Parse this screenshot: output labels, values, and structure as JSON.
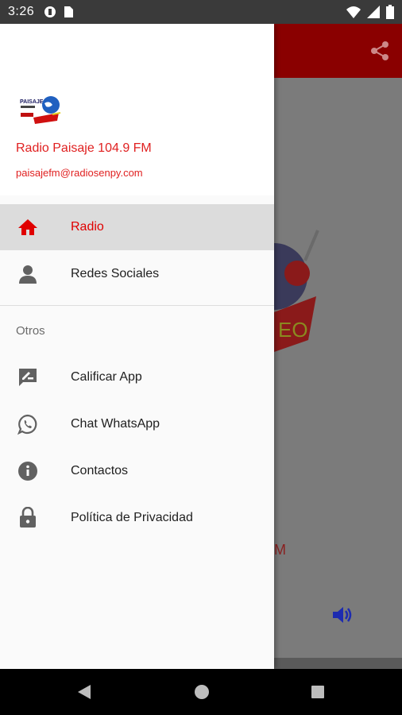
{
  "status_bar": {
    "time": "3:26",
    "left_icons": [
      "vpn-key-icon",
      "sim-card-icon"
    ],
    "right_icons": [
      "wifi-icon",
      "signal-icon",
      "battery-icon"
    ]
  },
  "toolbar": {
    "color": "#8a0000",
    "share_icon": "share-icon"
  },
  "drawer": {
    "header": {
      "station_name": "Radio Paisaje 104.9 FM",
      "email": "paisajefm@radiosenpy.com",
      "logo_text": "PAISAJE"
    },
    "items": [
      {
        "label": "Radio",
        "icon": "home-icon",
        "active": true
      },
      {
        "label": "Redes Sociales",
        "icon": "person-icon",
        "active": false
      }
    ],
    "section_title": "Otros",
    "other_items": [
      {
        "label": "Calificar App",
        "icon": "rate-review-icon"
      },
      {
        "label": "Chat WhatsApp",
        "icon": "whatsapp-icon"
      },
      {
        "label": "Contactos",
        "icon": "info-icon"
      },
      {
        "label": "Política de Privacidad",
        "icon": "lock-icon"
      }
    ]
  },
  "background": {
    "volume_icon": "volume-icon"
  },
  "navbar": {
    "buttons": [
      "back-button",
      "home-button",
      "recents-button"
    ]
  },
  "colors": {
    "accent": "#e00000",
    "toolbar": "#8a0000",
    "active_bg": "#dcdcdc"
  }
}
